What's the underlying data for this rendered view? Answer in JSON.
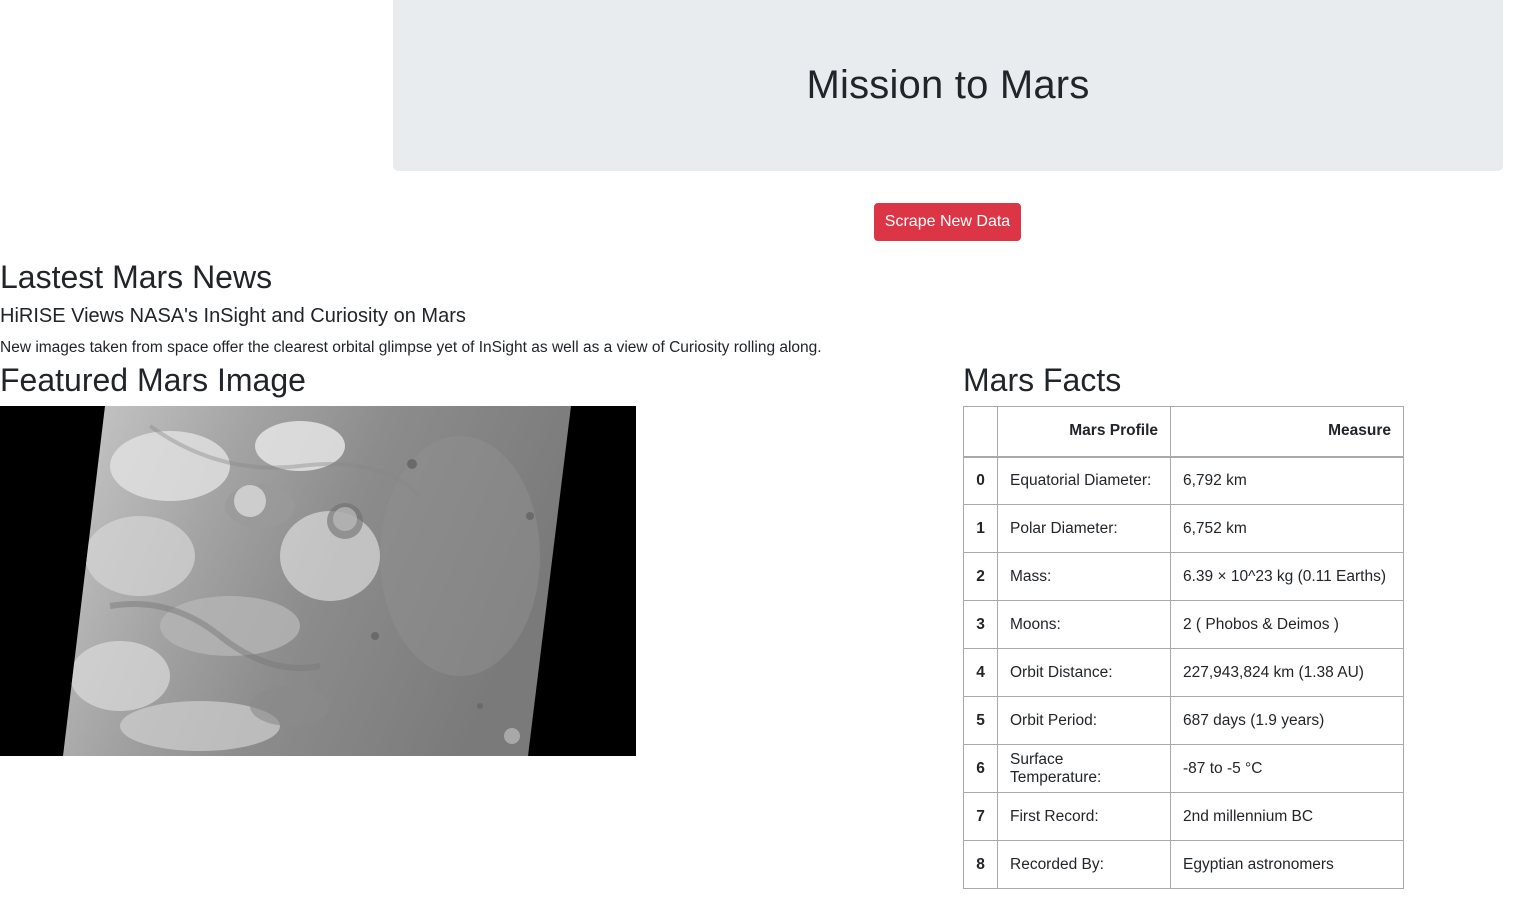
{
  "header": {
    "title": "Mission to Mars"
  },
  "actions": {
    "scrape_label": "Scrape New Data"
  },
  "news": {
    "heading": "Lastest Mars News",
    "title": "HiRISE Views NASA's InSight and Curiosity on Mars",
    "teaser": "New images taken from space offer the clearest orbital glimpse yet of InSight as well as a view of Curiosity rolling along."
  },
  "featured": {
    "heading": "Featured Mars Image"
  },
  "facts": {
    "heading": "Mars Facts",
    "columns": [
      "",
      "Mars Profile",
      "Measure"
    ],
    "rows": [
      {
        "index": "0",
        "profile": "Equatorial Diameter:",
        "measure": "6,792 km"
      },
      {
        "index": "1",
        "profile": "Polar Diameter:",
        "measure": "6,752 km"
      },
      {
        "index": "2",
        "profile": "Mass:",
        "measure": "6.39 × 10^23 kg (0.11 Earths)"
      },
      {
        "index": "3",
        "profile": "Moons:",
        "measure": "2 ( Phobos & Deimos )"
      },
      {
        "index": "4",
        "profile": "Orbit Distance:",
        "measure": "227,943,824 km (1.38 AU)"
      },
      {
        "index": "5",
        "profile": "Orbit Period:",
        "measure": "687 days (1.9 years)"
      },
      {
        "index": "6",
        "profile": "Surface Temperature:",
        "measure": "-87 to -5 °C"
      },
      {
        "index": "7",
        "profile": "First Record:",
        "measure": "2nd millennium BC"
      },
      {
        "index": "8",
        "profile": "Recorded By:",
        "measure": "Egyptian astronomers"
      }
    ]
  }
}
